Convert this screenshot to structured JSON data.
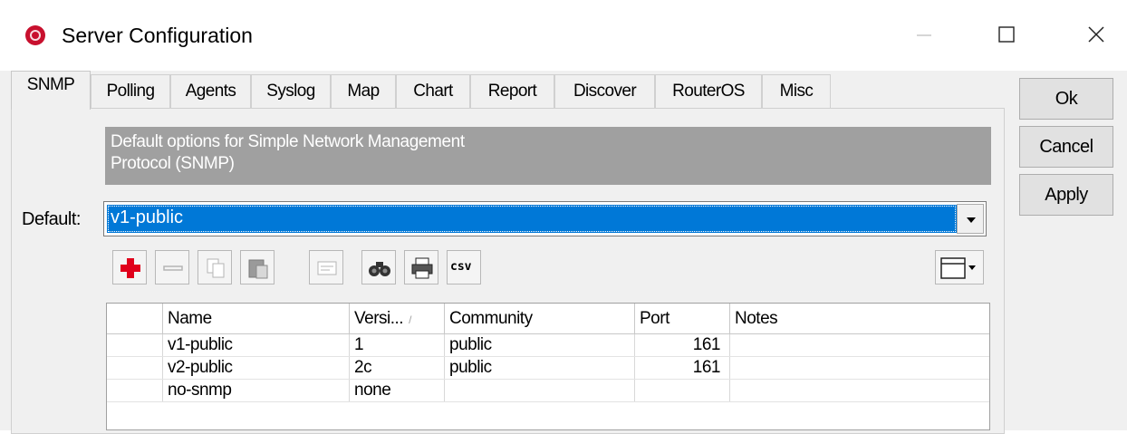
{
  "window": {
    "title": "Server Configuration",
    "app_icon": "router-app-icon",
    "controls": {
      "minimize": "minimize-icon",
      "maximize": "maximize-icon",
      "close": "close-icon"
    }
  },
  "tabs": [
    {
      "label": "SNMP",
      "active": true
    },
    {
      "label": "Polling"
    },
    {
      "label": "Agents"
    },
    {
      "label": "Syslog"
    },
    {
      "label": "Map"
    },
    {
      "label": "Chart"
    },
    {
      "label": "Report"
    },
    {
      "label": "Discover"
    },
    {
      "label": "RouterOS"
    },
    {
      "label": "Misc"
    }
  ],
  "buttons": {
    "ok": "Ok",
    "cancel": "Cancel",
    "apply": "Apply"
  },
  "banner": {
    "line1": "Default options for Simple Network Management",
    "line2": "Protocol (SNMP)"
  },
  "default_field": {
    "label": "Default:",
    "value": "v1-public"
  },
  "toolbar": {
    "items": [
      "add-icon",
      "remove-icon",
      "copy-icon",
      "paste-icon",
      "comment-icon",
      "find-icon",
      "print-icon",
      "csv-export-icon",
      "column-chooser-icon"
    ],
    "csv_label": "csv"
  },
  "grid": {
    "columns": [
      "",
      "Name",
      "Versi...",
      "Community",
      "Port",
      "Notes"
    ],
    "rows": [
      {
        "name": "v1-public",
        "version": "1",
        "community": "public",
        "port": "161",
        "notes": ""
      },
      {
        "name": "v2-public",
        "version": "2c",
        "community": "public",
        "port": "161",
        "notes": ""
      },
      {
        "name": "no-snmp",
        "version": "none",
        "community": "",
        "port": "",
        "notes": ""
      }
    ]
  },
  "colors": {
    "selection": "#0078d7",
    "banner": "#a0a0a0",
    "add": "#e0001b"
  }
}
